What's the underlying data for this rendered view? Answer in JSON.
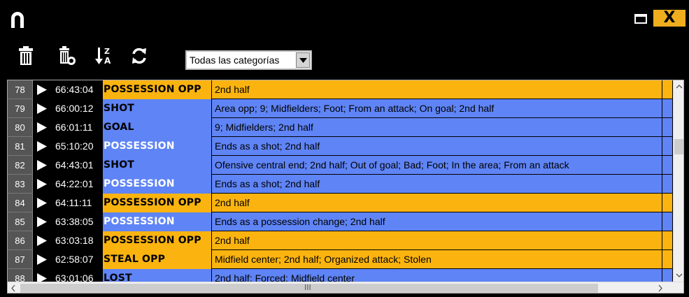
{
  "window": {
    "close_label": "X",
    "colors": {
      "background": "#000000",
      "close_button": "#f0ad1e"
    }
  },
  "toolbar": {
    "category_filter": {
      "selected": "Todas las categorías"
    }
  },
  "colors": {
    "orange": "#fbb40f",
    "blue": "#5f84f5",
    "cat_text_blue": "#000000",
    "cat_text_white": "#ffffff"
  },
  "events": [
    {
      "num": "78",
      "time": "66:43:04",
      "category": "POSSESSION OPP",
      "description": "2nd half",
      "color": "orange"
    },
    {
      "num": "79",
      "time": "66:00:12",
      "category": "SHOT",
      "description": "Area opp; 9; Midfielders; Foot; From an attack; On goal; 2nd half",
      "color": "blue"
    },
    {
      "num": "80",
      "time": "66:01:11",
      "category": "GOAL",
      "description": "9; Midfielders; 2nd half",
      "color": "blue"
    },
    {
      "num": "81",
      "time": "65:10:20",
      "category": "POSSESSION",
      "description": "Ends as a shot; 2nd half",
      "color": "blue",
      "white_cat": true
    },
    {
      "num": "82",
      "time": "64:43:01",
      "category": "SHOT",
      "description": "Ofensive central end; 2nd half; Out of goal; Bad; Foot; In the area; From an attack",
      "color": "blue"
    },
    {
      "num": "83",
      "time": "64:22:01",
      "category": "POSSESSION",
      "description": "Ends as a shot; 2nd half",
      "color": "blue",
      "white_cat": true
    },
    {
      "num": "84",
      "time": "64:11:11",
      "category": "POSSESSION OPP",
      "description": "2nd half",
      "color": "orange"
    },
    {
      "num": "85",
      "time": "63:38:05",
      "category": "POSSESSION",
      "description": "Ends as a possession change; 2nd half",
      "color": "blue",
      "white_cat": true
    },
    {
      "num": "86",
      "time": "63:03:18",
      "category": "POSSESSION OPP",
      "description": "2nd half",
      "color": "orange"
    },
    {
      "num": "87",
      "time": "62:58:07",
      "category": "STEAL OPP",
      "description": "Midfield center; 2nd half; Organized attack; Stolen",
      "color": "orange"
    },
    {
      "num": "88",
      "time": "63:01:06",
      "category": "LOST",
      "description": "2nd half; Forced; Midfield center",
      "color": "blue"
    }
  ],
  "scrollbar": {
    "grip": "III"
  }
}
